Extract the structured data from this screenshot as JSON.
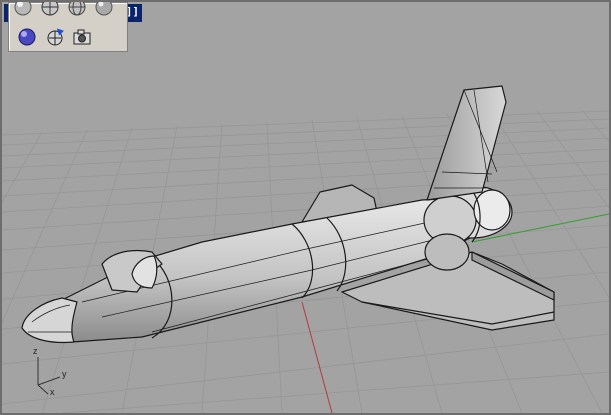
{
  "viewport": {
    "title": "]]",
    "axes": {
      "z": "z",
      "y": "y",
      "x": "x"
    }
  },
  "toolbar": {
    "tools": [
      {
        "name": "sphere-shaded-icon"
      },
      {
        "name": "sphere-wireframe-horizontal-icon"
      },
      {
        "name": "sphere-wireframe-grid-icon"
      },
      {
        "name": "sphere-plain-icon"
      },
      {
        "name": "sphere-rendered-blue-icon"
      },
      {
        "name": "rotate-view-icon"
      },
      {
        "name": "camera-icon"
      }
    ]
  },
  "colors": {
    "viewport_bg": "#a3a3a3",
    "grid_line": "#9a9a9a",
    "x_axis": "#b33a3a",
    "y_axis": "#2fa02f",
    "title_bar": "#0a246a"
  }
}
